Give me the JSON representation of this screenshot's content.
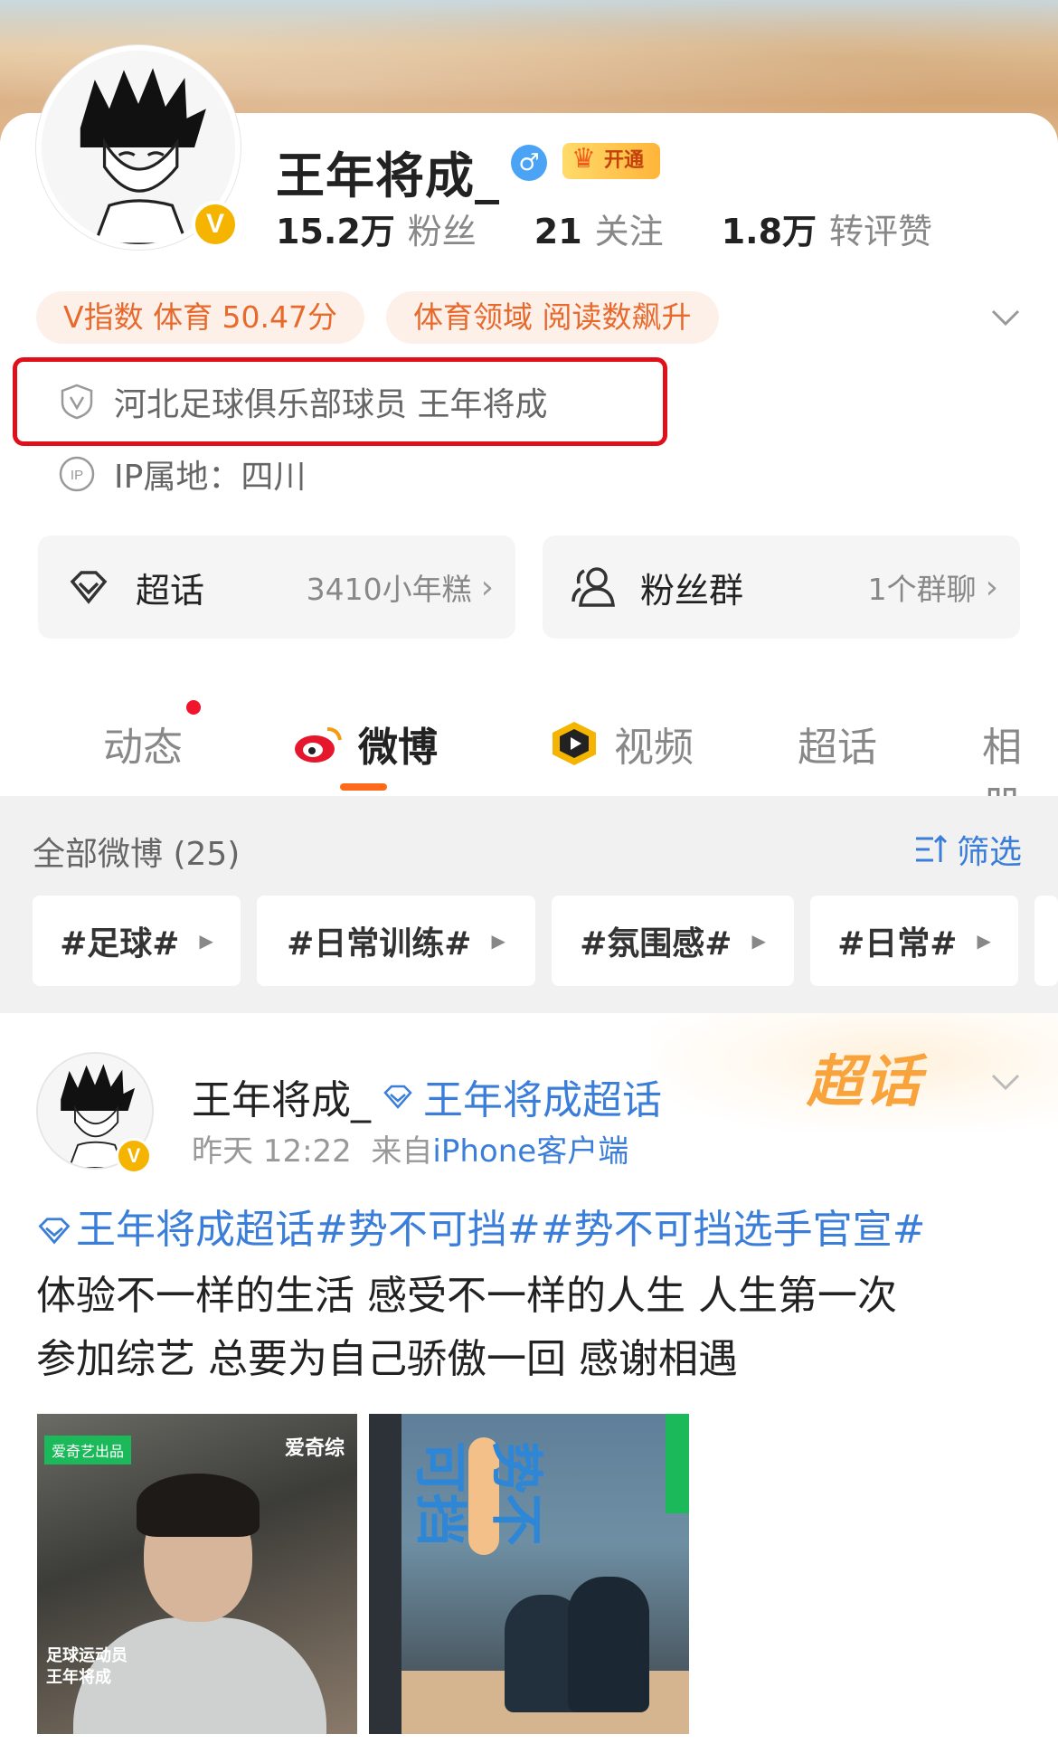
{
  "profile": {
    "name": "王年将成_",
    "vip_label": "开通",
    "stats": [
      {
        "value": "15.2万",
        "label": "粉丝"
      },
      {
        "value": "21",
        "label": "关注"
      },
      {
        "value": "1.8万",
        "label": "转评赞"
      }
    ],
    "tags": [
      "V指数 体育 50.47分",
      "体育领域 阅读数飙升"
    ],
    "verification": "河北足球俱乐部球员 王年将成",
    "ip_location": "IP属地：四川"
  },
  "tiles": [
    {
      "title": "超话",
      "sub": "3410小年糕",
      "arrow": "›"
    },
    {
      "title": "粉丝群",
      "sub": "1个群聊",
      "arrow": "›"
    }
  ],
  "tabs": [
    "动态",
    "微博",
    "视频",
    "超话",
    "相册"
  ],
  "filter_bar": {
    "all_label": "全部微博 (25)",
    "filter_label": "筛选",
    "chips": [
      "#足球#",
      "#日常训练#",
      "#氛围感#",
      "#日常#"
    ]
  },
  "post": {
    "author": "王年将成_",
    "supertopic": "王年将成超话",
    "time": "昨天 12:22",
    "source_prefix": "来自",
    "source": "iPhone客户端",
    "badge_text": "超话",
    "hashtag_text": "王年将成超话#势不可挡##势不可挡选手官宣#",
    "body_line1": "体验不一样的生活 感受不一样的人生 人生第一次",
    "body_line2": "参加综艺 总要为自己骄傲一回 感谢相遇",
    "image1": {
      "brand": "爱奇艺出品",
      "brand_right": "爱奇综",
      "caption": "足球运动员\n王年将成"
    },
    "image2": {
      "title": "势不可挡"
    }
  },
  "colors": {
    "accent_orange": "#ff6a1a",
    "link_blue": "#3a7ed9",
    "verify_red": "#e0101b",
    "tag_orange": "#e8692c",
    "badge_gold": "#f5b400"
  }
}
